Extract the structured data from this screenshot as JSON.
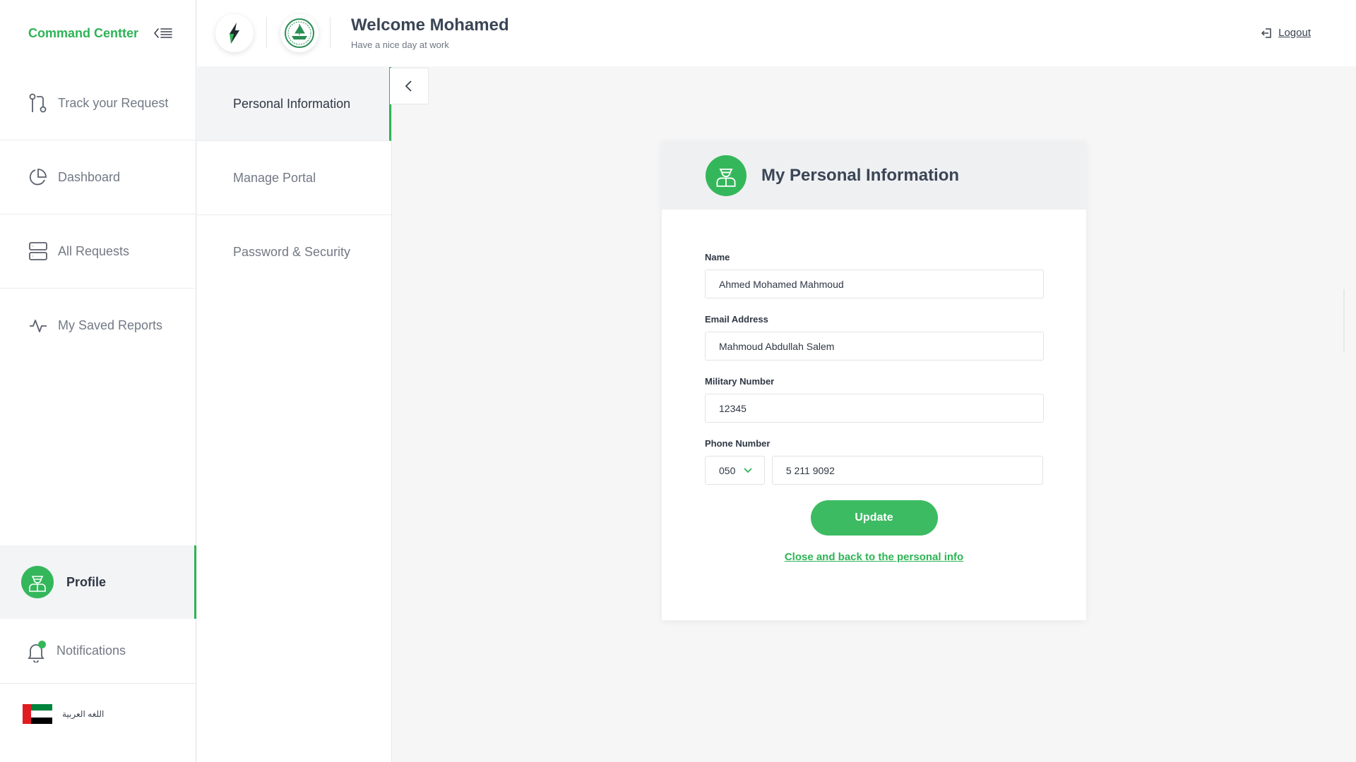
{
  "sidebar": {
    "brand": "Command Centter",
    "items": [
      {
        "label": "Track your Request",
        "icon": "git-pull-request-icon"
      },
      {
        "label": "Dashboard",
        "icon": "pie-chart-icon"
      },
      {
        "label": "All Requests",
        "icon": "server-icon"
      },
      {
        "label": "My Saved Reports",
        "icon": "activity-icon"
      }
    ],
    "profile": {
      "label": "Profile",
      "icon": "officer-avatar-icon"
    },
    "notifications": {
      "label": "Notifications",
      "icon": "bell-icon",
      "has_dot": true
    },
    "language": {
      "label": "اللغه العربية",
      "icon": "uae-flag-icon"
    }
  },
  "header": {
    "welcome": "Welcome Mohamed",
    "subtitle": "Have a nice day at work",
    "logout": "Logout"
  },
  "subnav": {
    "items": [
      {
        "label": "Personal Information",
        "active": true
      },
      {
        "label": "Manage Portal",
        "active": false
      },
      {
        "label": "Password & Security",
        "active": false
      }
    ]
  },
  "card": {
    "title": "My Personal Information",
    "fields": {
      "name": {
        "label": "Name",
        "value": "Ahmed Mohamed Mahmoud"
      },
      "email": {
        "label": "Email Address",
        "value": "Mahmoud Abdullah Salem"
      },
      "military": {
        "label": "Military Number",
        "value": "12345"
      },
      "phone": {
        "label": "Phone Number",
        "prefix": "050",
        "value": "5 211 9092"
      }
    },
    "update_label": "Update",
    "back_link": "Close and back to the personal info"
  },
  "colors": {
    "accent": "#2db456",
    "button": "#3cbb62",
    "text": "#3a4250",
    "muted": "#727985"
  }
}
